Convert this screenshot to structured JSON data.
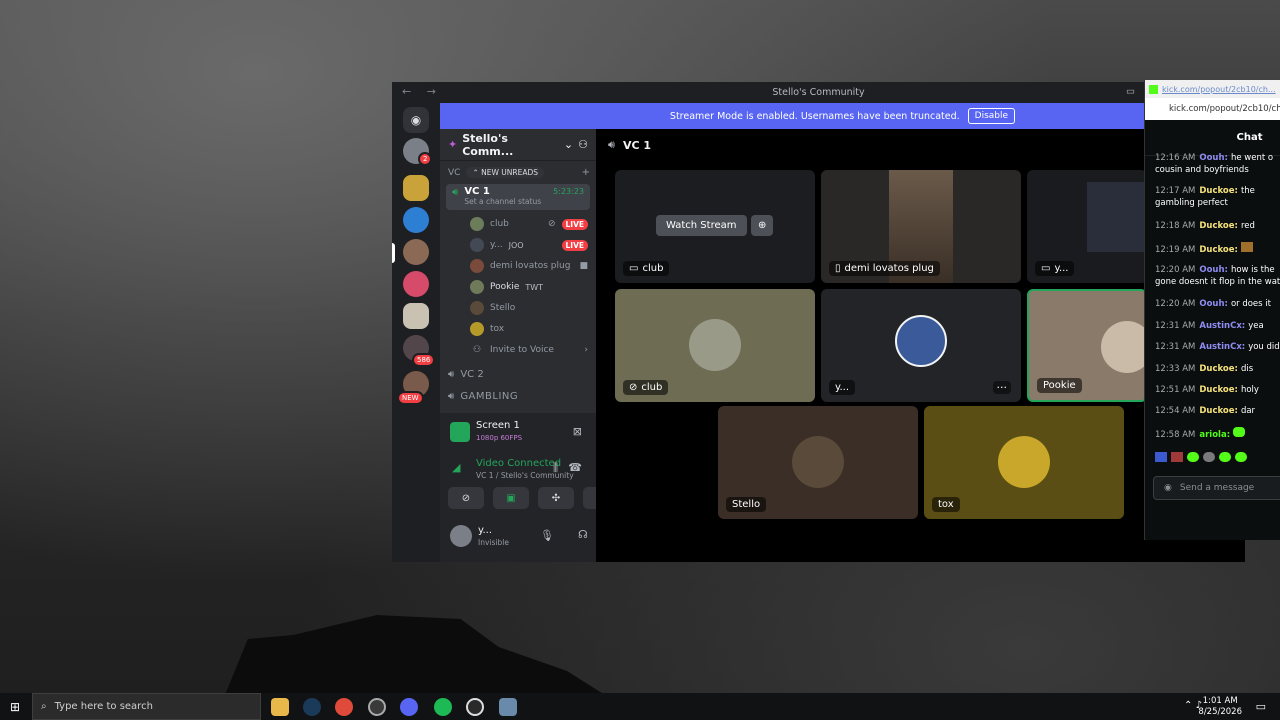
{
  "window": {
    "title": "Stello's Community",
    "banner_text": "Streamer Mode is enabled. Usernames have been truncated.",
    "banner_button": "Disable"
  },
  "servers": {
    "badges": {
      "dm": "2",
      "mention": "586",
      "new": "NEW"
    }
  },
  "sidebar": {
    "server_name": "Stello's Comm...",
    "category": "VC",
    "new_unreads": "NEW UNREADS",
    "active_channel": {
      "name": "VC 1",
      "timer": "5:23:23",
      "status": "Set a channel status"
    },
    "members": [
      {
        "name": "club",
        "tag": "",
        "live": "LIVE",
        "color": "#6b7d5a"
      },
      {
        "name": "y...",
        "tag": "JOO",
        "live": "LIVE",
        "color": "#444a55"
      },
      {
        "name": "demi lovatos plug",
        "tag": "",
        "live": "",
        "color": "#7a4a3a"
      },
      {
        "name": "Pookie",
        "tag": "TWT",
        "live": "",
        "color": "#6e7a5a"
      },
      {
        "name": "Stello",
        "tag": "",
        "live": "",
        "color": "#5a4a3a"
      },
      {
        "name": "tox",
        "tag": "",
        "live": "",
        "color": "#b59a2a"
      }
    ],
    "invite": "Invite to Voice",
    "channel_vc2": "VC 2",
    "channel_gambling": "GAMBLING"
  },
  "panel": {
    "stream_title": "Screen 1",
    "stream_quality": "1080p 60FPS",
    "connected": "Video Connected",
    "connected_sub": "VC 1 / Stello's Community",
    "user_name": "y...",
    "user_status": "Invisible"
  },
  "call": {
    "channel": "VC 1",
    "watch_stream": "Watch Stream",
    "tiles": [
      "club",
      "demi lovatos plug",
      "y...",
      "club",
      "y...",
      "Pookie",
      "Stello",
      "tox"
    ]
  },
  "kick": {
    "url": "kick.com/popout/2cb10/chat",
    "tab_url": "kick.com/popout/2cb10/ch...",
    "header": "Chat",
    "messages": [
      {
        "time": "12:16 AM",
        "user": "Oouh:",
        "text": "he went o",
        "color": "#8f8cf2"
      },
      {
        "time": "",
        "user": "",
        "text": "cousin and boyfriends",
        "color": "#fff"
      },
      {
        "time": "12:17 AM",
        "user": "Duckoe:",
        "text": "the",
        "color": "#f5e27a"
      },
      {
        "time": "",
        "user": "",
        "text": "gambling perfect",
        "color": "#fff"
      },
      {
        "time": "12:18 AM",
        "user": "Duckoe:",
        "text": "red",
        "color": "#f5e27a"
      },
      {
        "time": "12:19 AM",
        "user": "Duckoe:",
        "text": "",
        "color": "#f5e27a"
      },
      {
        "time": "12:20 AM",
        "user": "Oouh:",
        "text": "how is the",
        "color": "#8f8cf2"
      },
      {
        "time": "",
        "user": "",
        "text": "gone doesnt it flop in the wat",
        "color": "#fff"
      },
      {
        "time": "12:20 AM",
        "user": "Oouh:",
        "text": "or does it",
        "color": "#8f8cf2"
      },
      {
        "time": "12:31 AM",
        "user": "AustinCx:",
        "text": "yea",
        "color": "#8f8cf2"
      },
      {
        "time": "12:31 AM",
        "user": "AustinCx:",
        "text": "you did",
        "color": "#8f8cf2"
      },
      {
        "time": "12:33 AM",
        "user": "Duckoe:",
        "text": "dis",
        "color": "#f5e27a"
      },
      {
        "time": "12:51 AM",
        "user": "Duckoe:",
        "text": "holy",
        "color": "#f5e27a"
      },
      {
        "time": "12:54 AM",
        "user": "Duckoe:",
        "text": "dar",
        "color": "#f5e27a"
      },
      {
        "time": "12:58 AM",
        "user": "ariola:",
        "text": "",
        "color": "#53fc18"
      }
    ],
    "input_placeholder": "Send a message"
  },
  "taskbar": {
    "search_placeholder": "Type here to search",
    "time": "1:01 AM",
    "date": "8/25/2026"
  }
}
